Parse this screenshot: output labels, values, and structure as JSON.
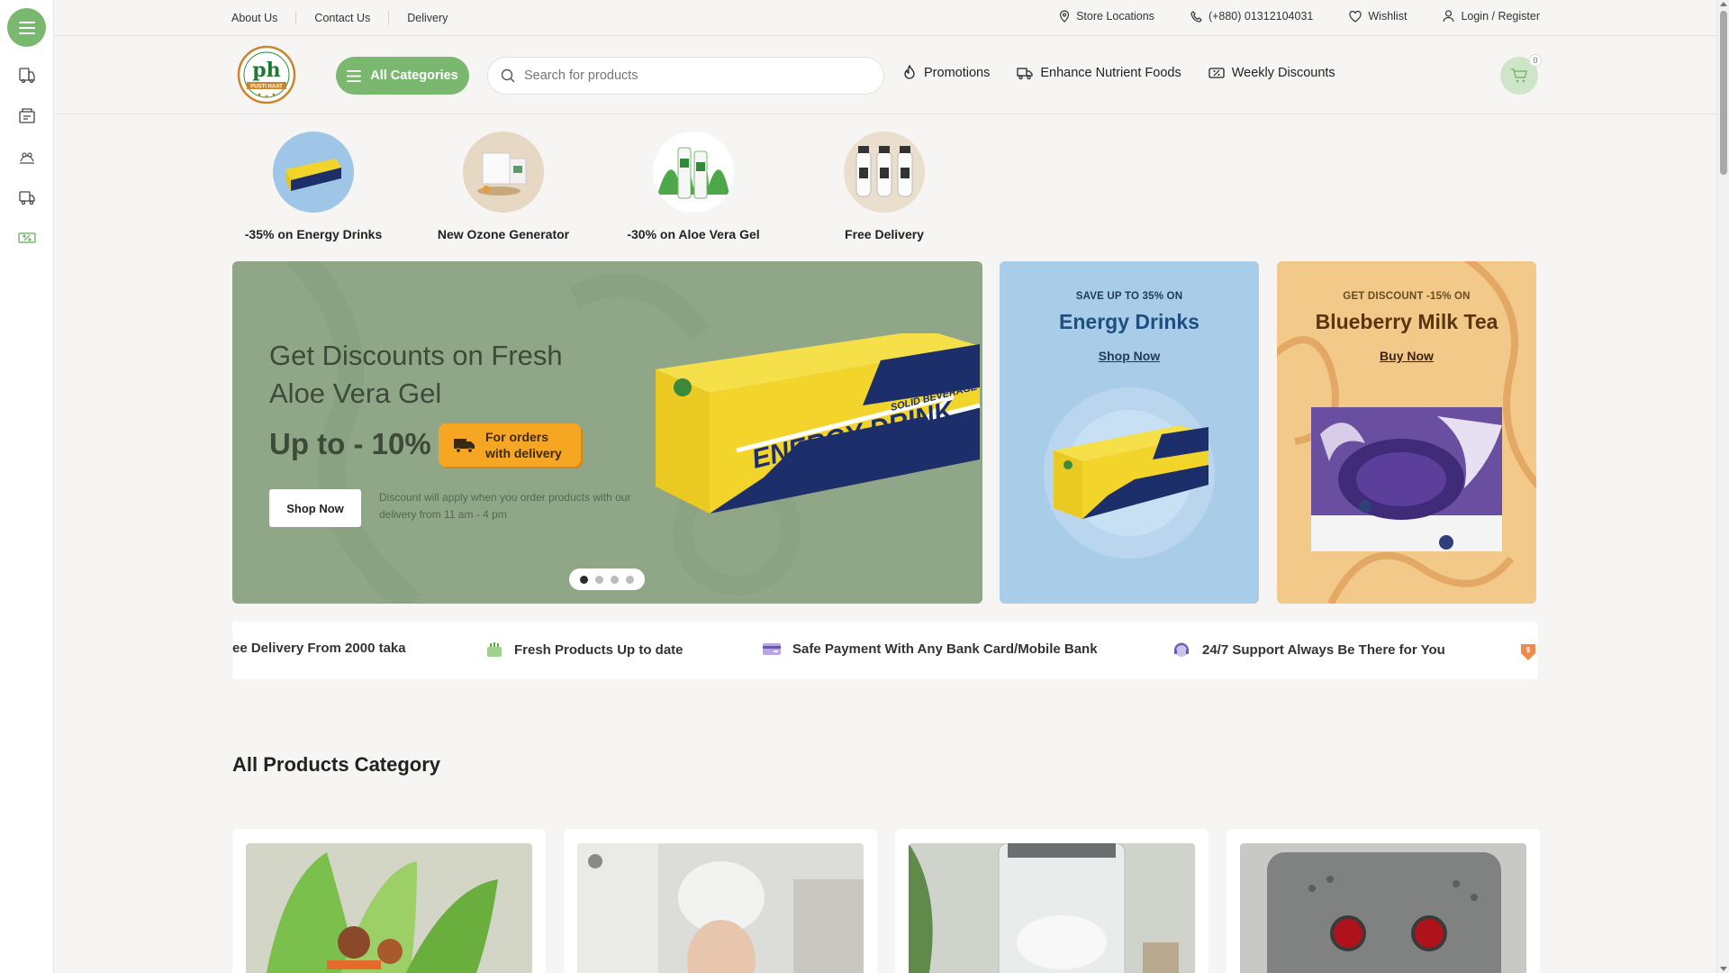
{
  "topbar": {
    "links": [
      "About Us",
      "Contact Us",
      "Delivery"
    ],
    "store_locations": "Store Locations",
    "phone": "(+880) 01312104031",
    "wishlist": "Wishlist",
    "login": "Login / Register"
  },
  "header": {
    "logo_text": "PUSTI HAAT",
    "all_categories": "All Categories",
    "search_placeholder": "Search for products",
    "nav": [
      "Promotions",
      "Enhance Nutrient Foods",
      "Weekly Discounts"
    ],
    "cart_count": "0"
  },
  "categories": [
    {
      "label": "-35% on Energy Drinks"
    },
    {
      "label": "New Ozone Generator"
    },
    {
      "label": "-30% on Aloe Vera Gel"
    },
    {
      "label": "Free Delivery"
    }
  ],
  "hero": {
    "title": "Get Discounts on Fresh Aloe Vera Gel",
    "upto": "Up to - 10%",
    "badge": "For orders with delivery",
    "button": "Shop Now",
    "note": "Discount will apply when you order products with our delivery from 11 am - 4 pm",
    "product_text": "ENERGY DRINK",
    "product_subtext": "SOLID BEVERAGE",
    "slides": 4,
    "active_slide": 1
  },
  "promos": [
    {
      "kicker": "SAVE UP TO 35% ON",
      "title": "Energy Drinks",
      "link": "Shop Now"
    },
    {
      "kicker": "GET DISCOUNT -15% ON",
      "title": "Blueberry Milk Tea",
      "link": "Buy Now"
    }
  ],
  "features": [
    "ee Delivery From 2000 taka",
    "Fresh Products Up to date",
    "Safe Payment With Any Bank Card/Mobile Bank",
    "24/7 Support Always Be There for You"
  ],
  "section_title": "All Products Category",
  "colors": {
    "brand_green": "#7ab870",
    "hero_bg": "#8fa787",
    "promo_blue": "#a9cce8",
    "promo_orange": "#f3c98a",
    "badge_orange": "#f6a623"
  }
}
